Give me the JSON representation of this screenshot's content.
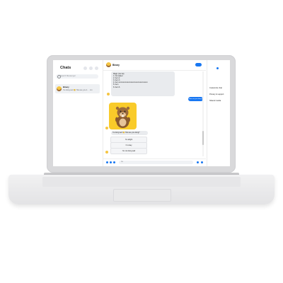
{
  "sidebar": {
    "title": "Chats",
    "search_placeholder": "Search Messenger",
    "chat": {
      "name": "Binary",
      "preview": "I'm doing well 😊 How are you d... · 1m"
    }
  },
  "conversation": {
    "contact_name": "Binary",
    "list_lines": [
      "Magic (Go list)",
      "1. Not called",
      "2. Item 2",
      "3. Item 3",
      "4. Item xxxxxxxxxxxxxxxxxxxxxxxxxxxxxxxxxx",
      "5. Item",
      "6. Item 6"
    ],
    "outgoing": "How are you doing?",
    "reply": "I'm doing well 😊 How are you doing?",
    "quick_replies": [
      "I'm alright",
      "I'm okay",
      "I'm not doing well"
    ],
    "composer_placeholder": "Aa"
  },
  "right_panel": {
    "items": [
      "Customize chat",
      "Privacy & support",
      "Shared media"
    ]
  },
  "colors": {
    "accent": "#1877f2",
    "sticker_bg": "#f9cb2a"
  }
}
